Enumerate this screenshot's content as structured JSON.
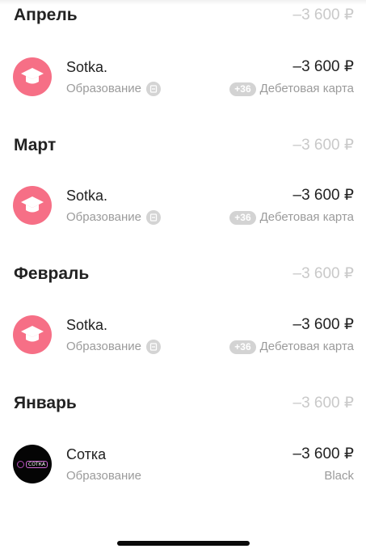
{
  "months": [
    {
      "title": "Апрель",
      "total": "–3 600 ₽",
      "transaction": {
        "name": "Sotka.",
        "category": "Образование",
        "amount": "–3 600 ₽",
        "bonus": "+36",
        "payment": "Дебетовая карта",
        "icon": "graduation-cap-icon"
      }
    },
    {
      "title": "Март",
      "total": "–3 600 ₽",
      "transaction": {
        "name": "Sotka.",
        "category": "Образование",
        "amount": "–3 600 ₽",
        "bonus": "+36",
        "payment": "Дебетовая карта",
        "icon": "graduation-cap-icon"
      }
    },
    {
      "title": "Февраль",
      "total": "–3 600 ₽",
      "transaction": {
        "name": "Sotka.",
        "category": "Образование",
        "amount": "–3 600 ₽",
        "bonus": "+36",
        "payment": "Дебетовая карта",
        "icon": "graduation-cap-icon"
      }
    },
    {
      "title": "Январь",
      "total": "–3 600 ₽",
      "transaction": {
        "name": "Сотка",
        "category": "Образование",
        "amount": "–3 600 ₽",
        "payment": "Black",
        "logo_text": "СОТКА",
        "icon": "sotka-logo-icon"
      }
    }
  ],
  "colors": {
    "accent_pink": "#f66f86",
    "muted_text": "#9b9b9b",
    "header_total": "#c9c9c9",
    "pill_bg": "#d3d3d3"
  }
}
